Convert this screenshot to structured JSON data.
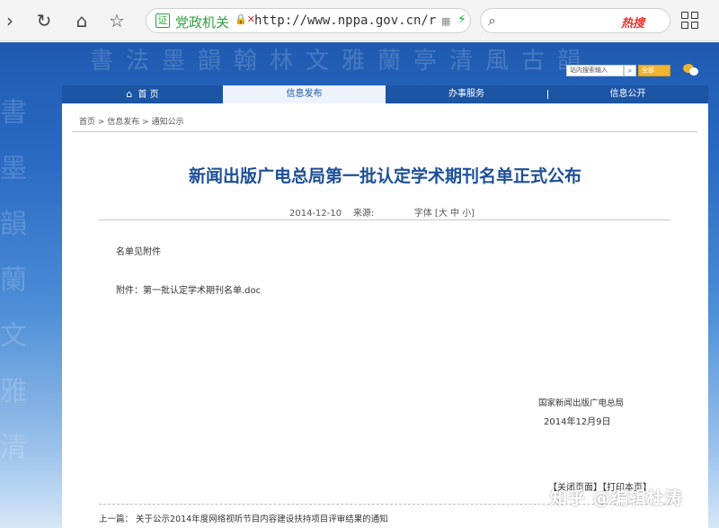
{
  "browser": {
    "site_name": "党政机关",
    "url": "http://www.nppa.gov.cn/r",
    "search_hot_label": "热搜"
  },
  "site": {
    "search_placeholder": "站内搜索输入",
    "search_option": "全部",
    "nav": [
      {
        "label": "首 页"
      },
      {
        "label": "信息发布"
      },
      {
        "label": "办事服务"
      },
      {
        "label": "信息公开"
      }
    ]
  },
  "breadcrumb": {
    "home": "首页",
    "sep": " > ",
    "level1": "信息发布",
    "level2": "通知公示"
  },
  "article": {
    "title": "新闻出版广电总局第一批认定学术期刊名单正式公布",
    "date": "2014-12-10",
    "source_label": "来源:",
    "font_label": "字体",
    "font_sizes": "[大 中 小]",
    "paragraph1": "名单见附件",
    "attachment_prefix": "附件：",
    "attachment_name": "第一批认定学术期刊名单.doc",
    "signature_org": "国家新闻出版广电总局",
    "signature_date": "2014年12月9日",
    "close_page": "【关闭页面】",
    "print_page": "【打印本页】",
    "prev_label": "上一篇：",
    "prev_title": "关于公示2014年度网络视听节目内容建设扶持项目评审结果的通知"
  },
  "watermark": "知乎 @编辑杜涛",
  "colors": {
    "nav_blue": "#1c55a4",
    "title_blue": "#1d4f96",
    "cert_green": "#2e9e3e",
    "hot_red": "#e8332b"
  }
}
